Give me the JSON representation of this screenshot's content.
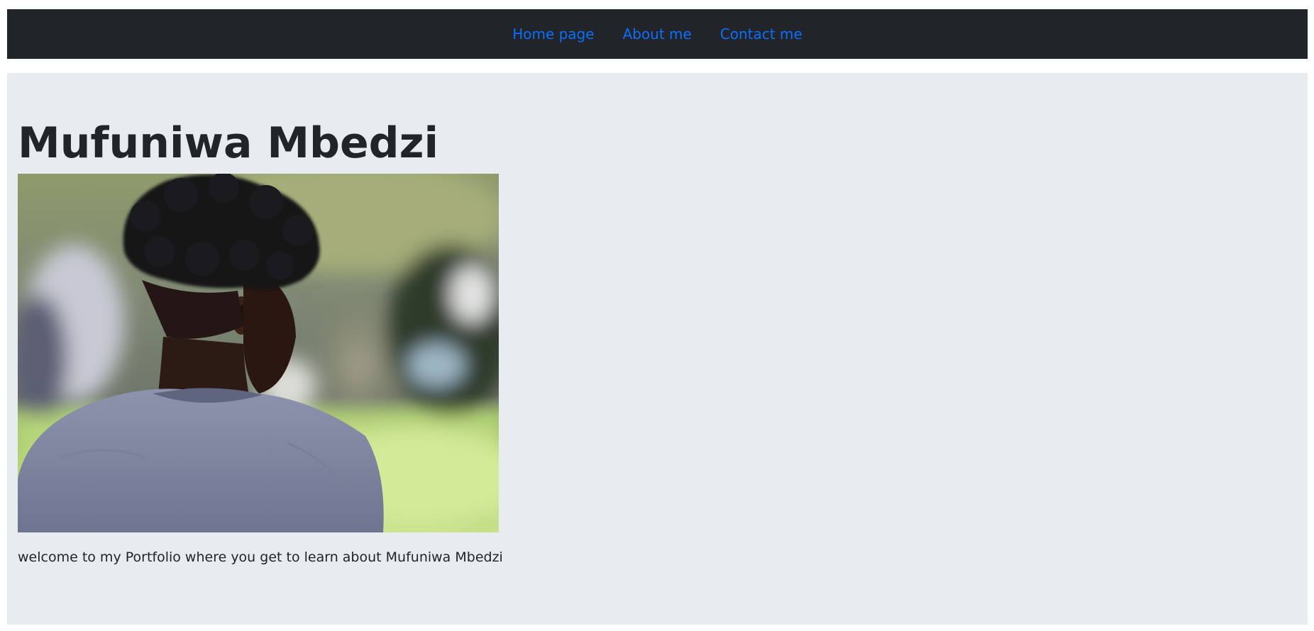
{
  "nav": {
    "items": [
      {
        "label": "Home page"
      },
      {
        "label": "About me"
      },
      {
        "label": "Contact me"
      }
    ]
  },
  "hero": {
    "title": "Mufuniwa Mbedzi",
    "intro": "welcome to my Portfolio where you get to learn about Mufuniwa Mbedzi"
  },
  "colors": {
    "navbar_bg": "#212529",
    "link": "#0d6efd",
    "panel_bg": "#e9ecef",
    "text": "#212529"
  }
}
